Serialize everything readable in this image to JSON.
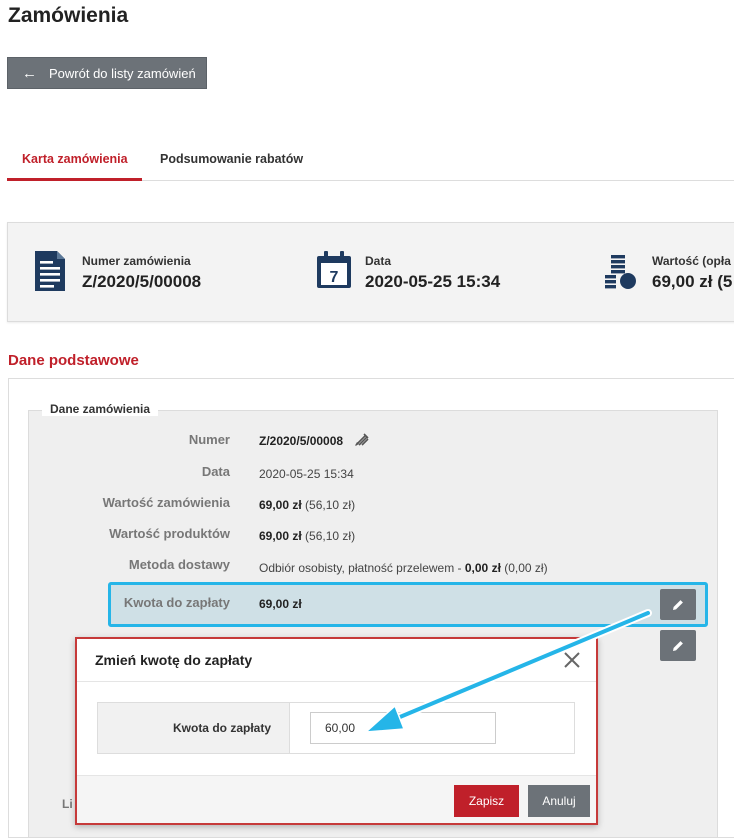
{
  "page": {
    "title": "Zamówienia"
  },
  "back_button": {
    "label": "Powrót do listy zamówień"
  },
  "tabs": [
    {
      "label": "Karta zamówienia",
      "active": true
    },
    {
      "label": "Podsumowanie rabatów",
      "active": false
    }
  ],
  "summary": {
    "order_number": {
      "label": "Numer zamówienia",
      "value": "Z/2020/5/00008",
      "icon": "document-icon"
    },
    "date": {
      "label": "Data",
      "value": "2020-05-25 15:34",
      "icon": "calendar-icon",
      "calendar_day": "7"
    },
    "value": {
      "label": "Wartość (opła",
      "value": "69,00 zł (5",
      "icon": "coins-icon"
    }
  },
  "section": {
    "title": "Dane podstawowe"
  },
  "order_details": {
    "legend": "Dane zamówienia",
    "rows": [
      {
        "label": "Numer",
        "value": "Z/2020/5/00008"
      },
      {
        "label": "Data",
        "value": "2020-05-25 15:34"
      },
      {
        "label": "Wartość zamówienia",
        "value_bold": "69,00 zł",
        "value_rest": " (56,10 zł)"
      },
      {
        "label": "Wartość produktów",
        "value_bold": "69,00 zł",
        "value_rest": " (56,10 zł)"
      },
      {
        "label": "Metoda dostawy",
        "value_pre": "Odbiór osobisty, płatność przelewem - ",
        "value_bold": "0,00 zł",
        "value_rest": " (0,00 zł)"
      },
      {
        "label": "Kwota do zapłaty",
        "value_bold": "69,00 zł"
      }
    ],
    "partial_label": "Li"
  },
  "modal": {
    "title": "Zmień kwotę do zapłaty",
    "field_label": "Kwota do zapłaty",
    "field_value": "60,00",
    "save_label": "Zapisz",
    "cancel_label": "Anuluj"
  },
  "colors": {
    "accent": "#c0202a",
    "highlight_border": "#25b5e8",
    "button_gray": "#6c7278",
    "icon_navy": "#1e3a5f"
  }
}
